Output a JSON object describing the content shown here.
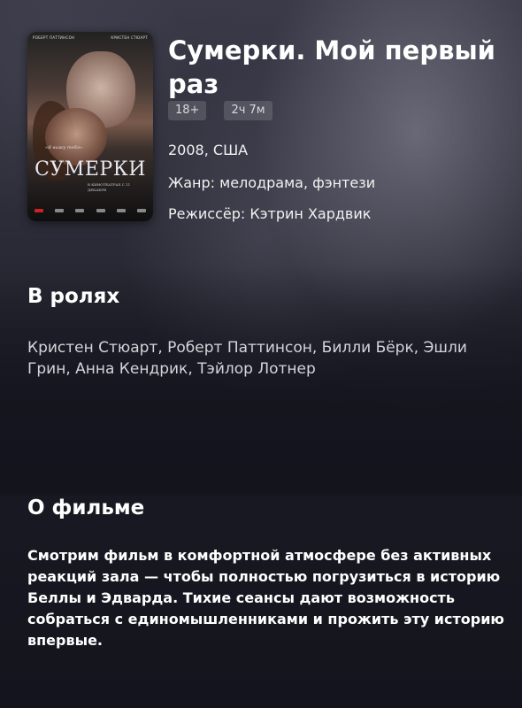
{
  "movie": {
    "title": "Сумерки. Мой первый раз",
    "age_rating": "18+",
    "duration": "2ч 7м",
    "year_country": "2008, США",
    "genre": "Жанр:  мелодрама, фэнтези",
    "director": "Режиссёр: Кэтрин Хардвик"
  },
  "poster": {
    "credits_left": "РОБЕРТ ПАТТИНСОН",
    "credits_right": "КРИСТЕН СТЮАРТ",
    "tagline": "«Я вижу тебя»",
    "title": "СУМЕРКИ",
    "release": "В КИНОТЕАТРАХ С 11 ДЕКАБРЯ"
  },
  "cast": {
    "heading": "В ролях",
    "text": "Кристен Стюарт, Роберт Паттинсон, Билли Бёрк, Эшли Грин, Анна Кендрик, Тэйлор Лотнер"
  },
  "about": {
    "heading": "О фильме",
    "text": "Смотрим фильм в комфортной атмосфере без активных реакций зала — чтобы полностью погрузиться в историю Беллы и Эдварда. Тихие сеансы дают возможность собраться с единомышленниками и прожить эту историю впервые."
  }
}
